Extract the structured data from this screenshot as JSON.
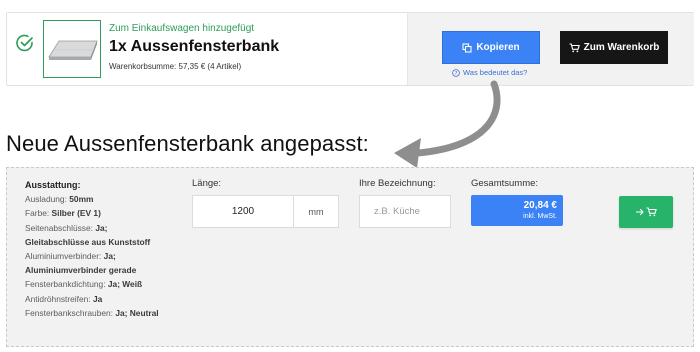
{
  "notice": {
    "status": "Zum Einkaufswagen hinzugefügt",
    "product": "1x Aussenfensterbank",
    "cart_sum": "Warenkorbsumme: 57,35 € (4 Artikel)",
    "copy_button": "Kopieren",
    "cart_button": "Zum Warenkorb",
    "help_link": "Was bedeutet das?"
  },
  "heading": "Neue Aussenfensterbank angepasst:",
  "spec": {
    "title": "Ausstattung:",
    "items": [
      {
        "label": "Ausladung:",
        "value": "50mm"
      },
      {
        "label": "Farbe:",
        "value": "Silber (EV 1)"
      },
      {
        "label": "Seitenabschlüsse:",
        "value": "Ja;"
      },
      {
        "label": "",
        "value": "Gleitabschlüsse aus Kunststoff"
      },
      {
        "label": "Aluminiumverbinder:",
        "value": "Ja;"
      },
      {
        "label": "",
        "value": "Aluminiumverbinder gerade"
      },
      {
        "label": "Fensterbankdichtung:",
        "value": "Ja; Weiß"
      },
      {
        "label": "Antidröhnstreifen:",
        "value": "Ja"
      },
      {
        "label": "Fensterbankschrauben:",
        "value": "Ja; Neutral"
      }
    ]
  },
  "length": {
    "label": "Länge:",
    "value": "1200",
    "unit": "mm"
  },
  "designation": {
    "label": "Ihre Bezeichnung:",
    "placeholder": "z.B. Küche"
  },
  "total": {
    "label": "Gesamtsumme:",
    "price": "20,84 €",
    "tax": "inkl. MwSt."
  },
  "colors": {
    "accent_blue": "#3a82f6",
    "success_green": "#27b36a",
    "cart_black": "#161616"
  },
  "icons": {
    "status": "check-circle-icon",
    "copy": "copy-icon",
    "cart": "cart-icon",
    "help": "question-circle-icon",
    "add": "arrow-cart-icon"
  }
}
